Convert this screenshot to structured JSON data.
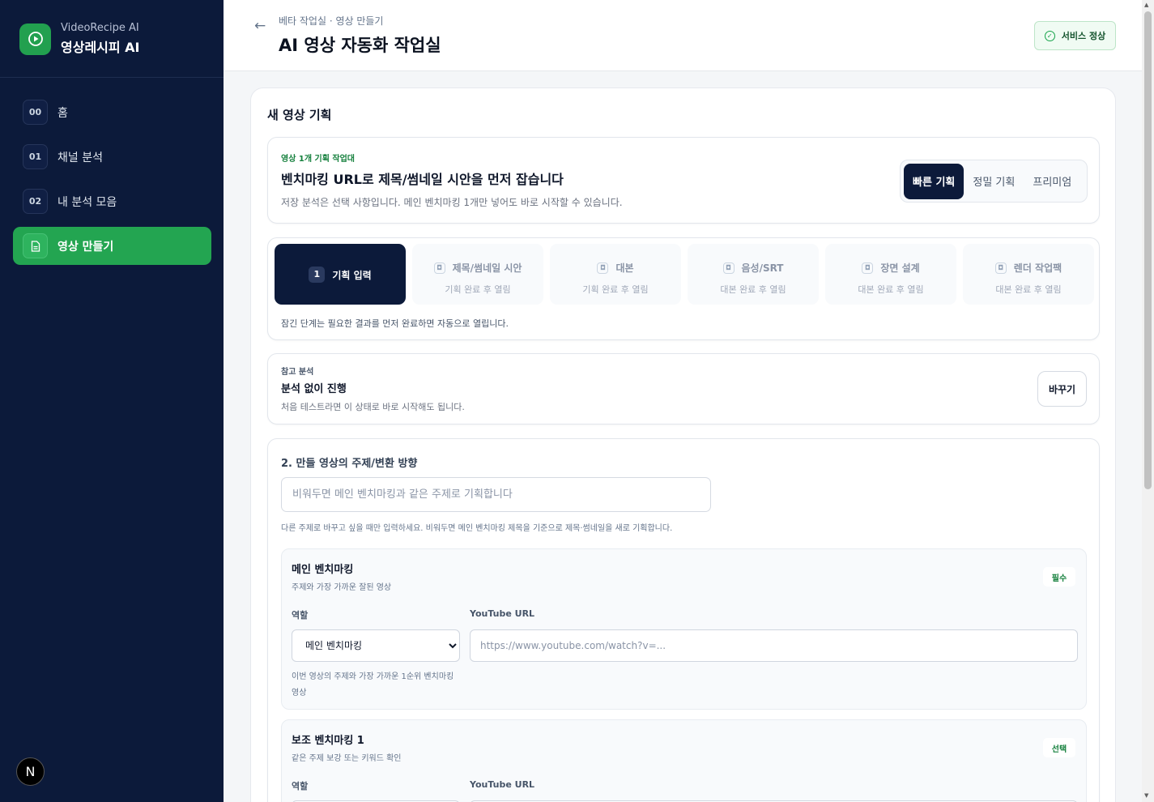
{
  "app": {
    "subtitle": "VideoRecipe AI",
    "name": "영상레시피 AI"
  },
  "sidebar": {
    "items": [
      {
        "num": "00",
        "label": "홈"
      },
      {
        "num": "01",
        "label": "채널 분석"
      },
      {
        "num": "02",
        "label": "내 분석 모음"
      },
      {
        "num": "",
        "label": "영상 만들기",
        "active": true
      }
    ],
    "badge": "N"
  },
  "header": {
    "breadcrumb": "베타 작업실 · 영상 만들기",
    "title": "AI 영상 자동화 작업실",
    "status": "서비스 정상"
  },
  "card": {
    "title": "새 영상 기획"
  },
  "plan": {
    "eyebrow": "영상 1개 기획 작업대",
    "headline": "벤치마킹 URL로 제목/썸네일 시안을 먼저 잡습니다",
    "description": "저장 분석은 선택 사항입니다. 메인 벤치마킹 1개만 넣어도 바로 시작할 수 있습니다.",
    "modes": [
      "빠른 기획",
      "정밀 기획",
      "프리미엄"
    ],
    "active_mode": "빠른 기획"
  },
  "steps": {
    "items": [
      {
        "num": "1",
        "title": "기획 입력",
        "active": true
      },
      {
        "title": "제목/썸네일 시안",
        "sub": "기획 완료 후 열림"
      },
      {
        "title": "대본",
        "sub": "기획 완료 후 열림"
      },
      {
        "title": "음성/SRT",
        "sub": "대본 완료 후 열림"
      },
      {
        "title": "장면 설계",
        "sub": "대본 완료 후 열림"
      },
      {
        "title": "렌더 작업팩",
        "sub": "대본 완료 후 열림"
      }
    ],
    "note": "잠긴 단계는 필요한 결과를 먼저 완료하면 자동으로 열립니다."
  },
  "reference": {
    "label": "참고 분석",
    "title": "분석 없이 진행",
    "description": "처음 테스트라면 이 상태로 바로 시작해도 됩니다.",
    "button": "바꾸기"
  },
  "topic": {
    "label": "2. 만들 영상의 주제/변환 방향",
    "placeholder": "비워두면 메인 벤치마킹과 같은 주제로 기획합니다",
    "help": "다른 주제로 바꾸고 싶을 때만 입력하세요. 비워두면 메인 벤치마킹 제목을 기준으로 제목·썸네일을 새로 기획합니다."
  },
  "benchmarks": [
    {
      "title": "메인 벤치마킹",
      "description": "주제와 가장 가까운 잘된 영상",
      "tag": "필수",
      "role_label": "역할",
      "url_label": "YouTube URL",
      "role_value": "메인 벤치마킹",
      "url_placeholder": "https://www.youtube.com/watch?v=...",
      "role_help": "이번 영상의 주제와 가장 가까운 1순위 벤치마킹 영상"
    },
    {
      "title": "보조 벤치마킹 1",
      "description": "같은 주제 보강 또는 키워드 확인",
      "tag": "선택",
      "role_label": "역할",
      "url_label": "YouTube URL"
    }
  ]
}
